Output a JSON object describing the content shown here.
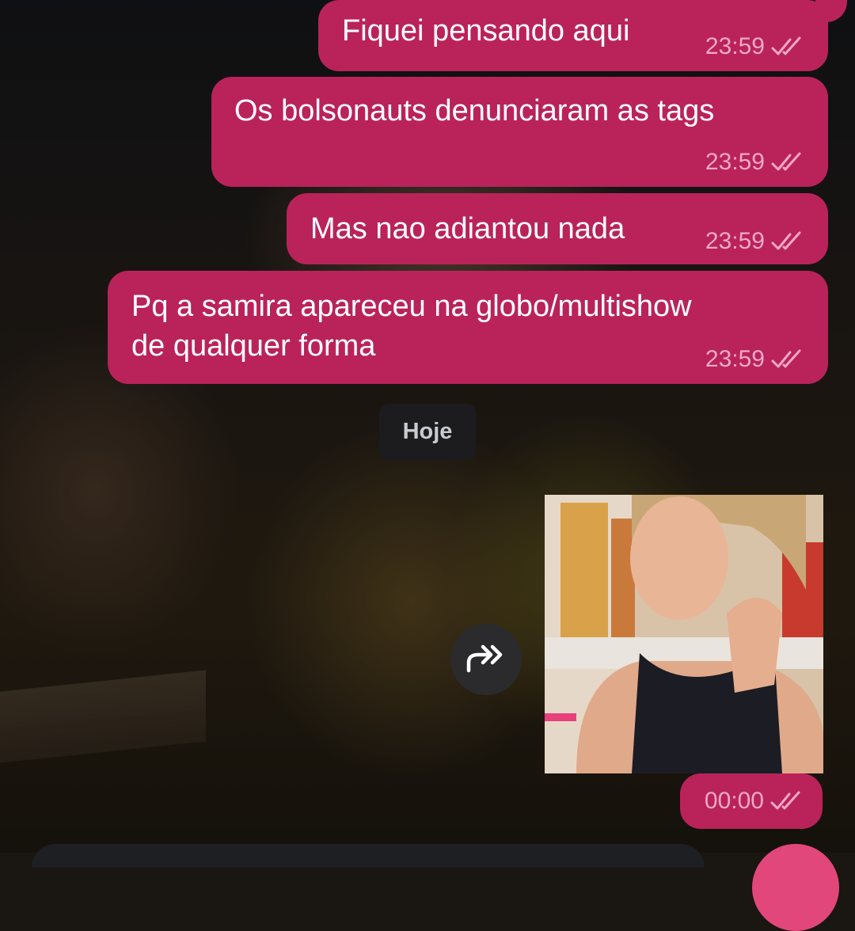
{
  "chat": {
    "messages": [
      {
        "text": "Fiquei pensando aqui",
        "time": "23:59",
        "status": "read"
      },
      {
        "text": "Os bolsonauts denunciaram as tags",
        "time": "23:59",
        "status": "read"
      },
      {
        "text": "Mas nao adiantou nada",
        "time": "23:59",
        "status": "read"
      },
      {
        "text": "Pq a samira apareceu na globo/multishow\nde qualquer forma",
        "time": "23:59",
        "status": "read"
      }
    ],
    "date_separator": "Hoje",
    "image_message": {
      "time": "00:00",
      "status": "read"
    }
  },
  "colors": {
    "outgoing_bubble": "#b9235a",
    "meta_text": "#f3a8c6",
    "date_chip_bg": "#1c1c1e",
    "forward_button_bg": "#2b2b2d"
  },
  "icons": {
    "read_receipt": "double-check-icon",
    "forward": "forward-icon"
  }
}
